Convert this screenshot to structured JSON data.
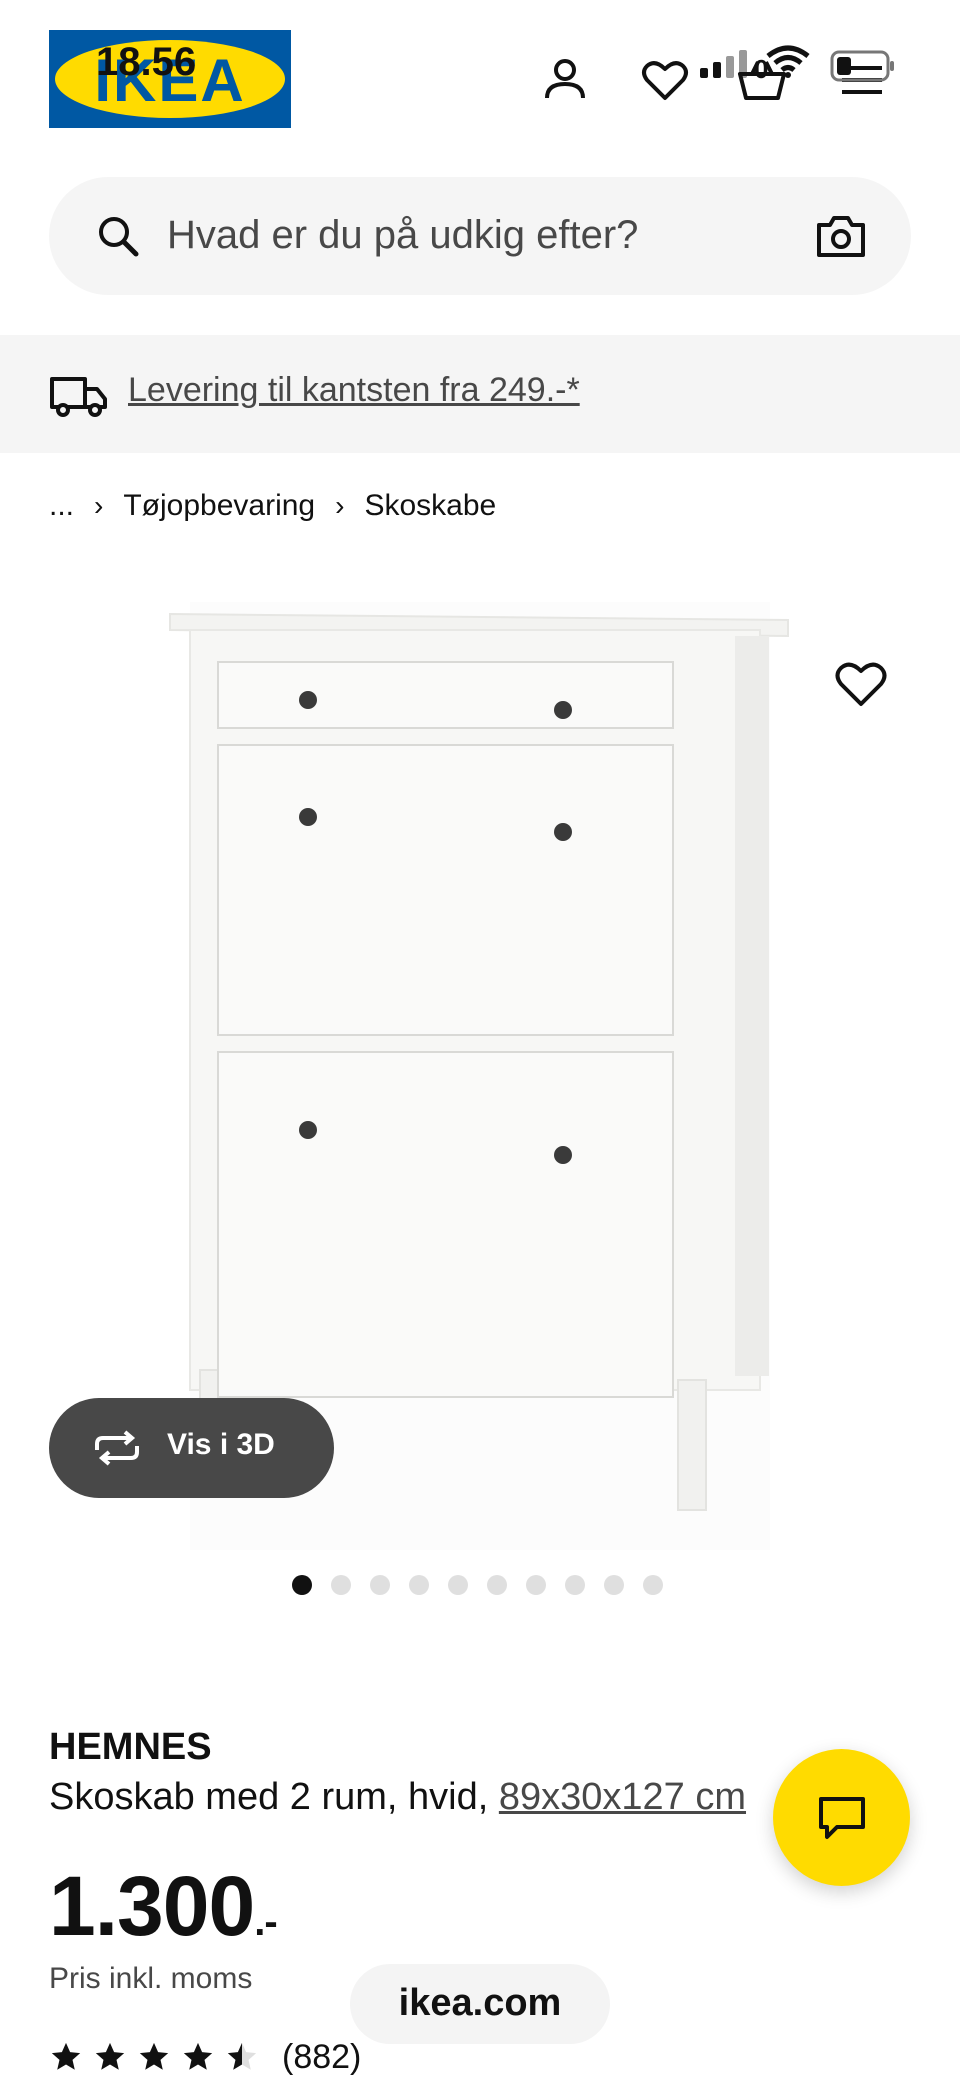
{
  "status_bar": {
    "time": "18.56"
  },
  "header": {
    "logo_text": "IKEA",
    "cart_count": "0"
  },
  "search": {
    "placeholder": "Hvad er du på udkig efter?"
  },
  "banner": {
    "text": "Levering til kantsten fra 249.-*"
  },
  "breadcrumb": {
    "ellipsis": "...",
    "items": [
      "Tøjopbevaring",
      "Skoskabe"
    ]
  },
  "gallery": {
    "vis3d_label": "Vis i 3D",
    "image_count": 10,
    "active_index": 0
  },
  "product": {
    "brand": "HEMNES",
    "description": "Skoskab med 2 rum, hvid, ",
    "size": "89x30x127 cm",
    "price": "1.300",
    "price_suffix": ".-",
    "vat_note": "Pris inkl. moms",
    "rating": 4.5,
    "review_count": "(882)"
  },
  "browser": {
    "url": "ikea.com"
  },
  "colors": {
    "ikea_blue": "#0058a3",
    "ikea_yellow": "#ffdb00",
    "dark_pill": "#484848"
  }
}
